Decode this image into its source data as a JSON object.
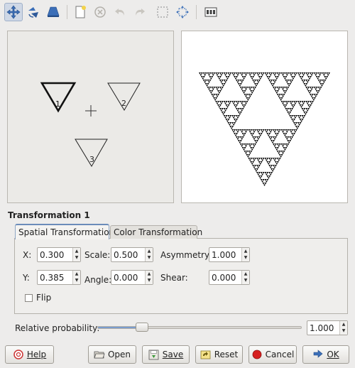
{
  "toolbar": {
    "buttons": [
      {
        "icon": "move-icon",
        "active": true
      },
      {
        "icon": "rotate-icon",
        "active": false
      },
      {
        "icon": "stretch-icon",
        "active": false
      },
      {
        "icon": "new-transform-icon",
        "active": false
      },
      {
        "icon": "delete-icon",
        "active": false
      },
      {
        "icon": "undo-icon",
        "active": false
      },
      {
        "icon": "redo-icon",
        "active": false
      },
      {
        "icon": "select-all-icon",
        "active": false
      },
      {
        "icon": "recompute-center-icon",
        "active": false
      },
      {
        "icon": "preview-toggle-icon",
        "active": false
      }
    ]
  },
  "design": {
    "triangles": [
      {
        "label": "1"
      },
      {
        "label": "2"
      },
      {
        "label": "3"
      }
    ]
  },
  "transformation_title": "Transformation 1",
  "tabs": [
    {
      "label": "Spatial Transformation",
      "active": true
    },
    {
      "label": "Color Transformation",
      "active": false
    }
  ],
  "spatial": {
    "x_label": "X:",
    "x_value": "0.300",
    "y_label": "Y:",
    "y_value": "0.385",
    "scale_label": "Scale:",
    "scale_value": "0.500",
    "angle_label": "Angle:",
    "angle_value": "0.000",
    "asymmetry_label": "Asymmetry:",
    "asymmetry_value": "1.000",
    "shear_label": "Shear:",
    "shear_value": "0.000",
    "flip_label": "Flip",
    "flip_checked": false
  },
  "probability": {
    "label": "Relative probability:",
    "value": "1.000",
    "slider_fraction": 0.22
  },
  "buttons": {
    "help": "Help",
    "open": "Open",
    "save": "Save",
    "reset": "Reset",
    "cancel": "Cancel",
    "ok": "OK"
  },
  "colors": {
    "accent": "#7a9ccc",
    "cancel_red": "#d62020"
  }
}
